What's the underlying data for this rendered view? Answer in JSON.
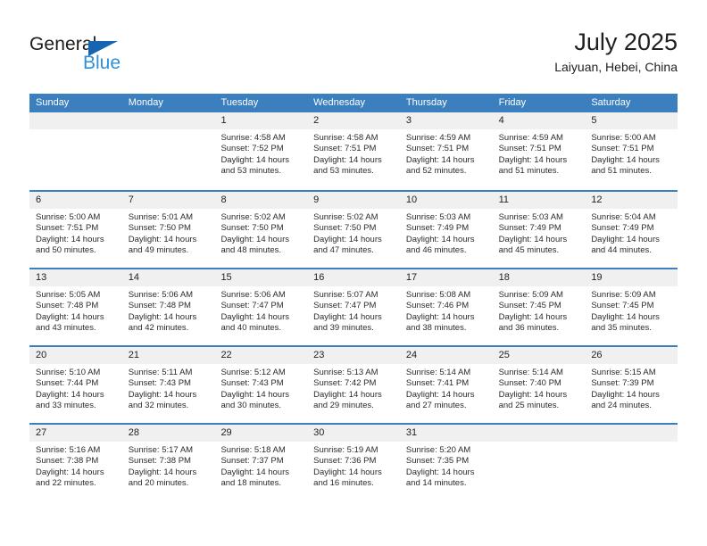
{
  "brand": {
    "name_top": "General",
    "name_bottom": "Blue",
    "triangle_color": "#1565b0",
    "blue_text_color": "#2f8fd8"
  },
  "header": {
    "title": "July 2025",
    "location": "Laiyuan, Hebei, China"
  },
  "theme": {
    "header_bar": "#3c7fbe",
    "day_number_band": "#f0f0f0",
    "cell_background": "#ffffff",
    "text": "#222222"
  },
  "weekdays": [
    "Sunday",
    "Monday",
    "Tuesday",
    "Wednesday",
    "Thursday",
    "Friday",
    "Saturday"
  ],
  "labels": {
    "sunrise_prefix": "Sunrise:",
    "sunset_prefix": "Sunset:",
    "daylight_prefix": "Daylight:"
  },
  "weeks": [
    [
      {
        "day": "",
        "empty": true
      },
      {
        "day": "",
        "empty": true
      },
      {
        "day": "1",
        "sunrise": "Sunrise: 4:58 AM",
        "sunset": "Sunset: 7:52 PM",
        "daylight_line1": "Daylight: 14 hours",
        "daylight_line2": "and 53 minutes."
      },
      {
        "day": "2",
        "sunrise": "Sunrise: 4:58 AM",
        "sunset": "Sunset: 7:51 PM",
        "daylight_line1": "Daylight: 14 hours",
        "daylight_line2": "and 53 minutes."
      },
      {
        "day": "3",
        "sunrise": "Sunrise: 4:59 AM",
        "sunset": "Sunset: 7:51 PM",
        "daylight_line1": "Daylight: 14 hours",
        "daylight_line2": "and 52 minutes."
      },
      {
        "day": "4",
        "sunrise": "Sunrise: 4:59 AM",
        "sunset": "Sunset: 7:51 PM",
        "daylight_line1": "Daylight: 14 hours",
        "daylight_line2": "and 51 minutes."
      },
      {
        "day": "5",
        "sunrise": "Sunrise: 5:00 AM",
        "sunset": "Sunset: 7:51 PM",
        "daylight_line1": "Daylight: 14 hours",
        "daylight_line2": "and 51 minutes."
      }
    ],
    [
      {
        "day": "6",
        "sunrise": "Sunrise: 5:00 AM",
        "sunset": "Sunset: 7:51 PM",
        "daylight_line1": "Daylight: 14 hours",
        "daylight_line2": "and 50 minutes."
      },
      {
        "day": "7",
        "sunrise": "Sunrise: 5:01 AM",
        "sunset": "Sunset: 7:50 PM",
        "daylight_line1": "Daylight: 14 hours",
        "daylight_line2": "and 49 minutes."
      },
      {
        "day": "8",
        "sunrise": "Sunrise: 5:02 AM",
        "sunset": "Sunset: 7:50 PM",
        "daylight_line1": "Daylight: 14 hours",
        "daylight_line2": "and 48 minutes."
      },
      {
        "day": "9",
        "sunrise": "Sunrise: 5:02 AM",
        "sunset": "Sunset: 7:50 PM",
        "daylight_line1": "Daylight: 14 hours",
        "daylight_line2": "and 47 minutes."
      },
      {
        "day": "10",
        "sunrise": "Sunrise: 5:03 AM",
        "sunset": "Sunset: 7:49 PM",
        "daylight_line1": "Daylight: 14 hours",
        "daylight_line2": "and 46 minutes."
      },
      {
        "day": "11",
        "sunrise": "Sunrise: 5:03 AM",
        "sunset": "Sunset: 7:49 PM",
        "daylight_line1": "Daylight: 14 hours",
        "daylight_line2": "and 45 minutes."
      },
      {
        "day": "12",
        "sunrise": "Sunrise: 5:04 AM",
        "sunset": "Sunset: 7:49 PM",
        "daylight_line1": "Daylight: 14 hours",
        "daylight_line2": "and 44 minutes."
      }
    ],
    [
      {
        "day": "13",
        "sunrise": "Sunrise: 5:05 AM",
        "sunset": "Sunset: 7:48 PM",
        "daylight_line1": "Daylight: 14 hours",
        "daylight_line2": "and 43 minutes."
      },
      {
        "day": "14",
        "sunrise": "Sunrise: 5:06 AM",
        "sunset": "Sunset: 7:48 PM",
        "daylight_line1": "Daylight: 14 hours",
        "daylight_line2": "and 42 minutes."
      },
      {
        "day": "15",
        "sunrise": "Sunrise: 5:06 AM",
        "sunset": "Sunset: 7:47 PM",
        "daylight_line1": "Daylight: 14 hours",
        "daylight_line2": "and 40 minutes."
      },
      {
        "day": "16",
        "sunrise": "Sunrise: 5:07 AM",
        "sunset": "Sunset: 7:47 PM",
        "daylight_line1": "Daylight: 14 hours",
        "daylight_line2": "and 39 minutes."
      },
      {
        "day": "17",
        "sunrise": "Sunrise: 5:08 AM",
        "sunset": "Sunset: 7:46 PM",
        "daylight_line1": "Daylight: 14 hours",
        "daylight_line2": "and 38 minutes."
      },
      {
        "day": "18",
        "sunrise": "Sunrise: 5:09 AM",
        "sunset": "Sunset: 7:45 PM",
        "daylight_line1": "Daylight: 14 hours",
        "daylight_line2": "and 36 minutes."
      },
      {
        "day": "19",
        "sunrise": "Sunrise: 5:09 AM",
        "sunset": "Sunset: 7:45 PM",
        "daylight_line1": "Daylight: 14 hours",
        "daylight_line2": "and 35 minutes."
      }
    ],
    [
      {
        "day": "20",
        "sunrise": "Sunrise: 5:10 AM",
        "sunset": "Sunset: 7:44 PM",
        "daylight_line1": "Daylight: 14 hours",
        "daylight_line2": "and 33 minutes."
      },
      {
        "day": "21",
        "sunrise": "Sunrise: 5:11 AM",
        "sunset": "Sunset: 7:43 PM",
        "daylight_line1": "Daylight: 14 hours",
        "daylight_line2": "and 32 minutes."
      },
      {
        "day": "22",
        "sunrise": "Sunrise: 5:12 AM",
        "sunset": "Sunset: 7:43 PM",
        "daylight_line1": "Daylight: 14 hours",
        "daylight_line2": "and 30 minutes."
      },
      {
        "day": "23",
        "sunrise": "Sunrise: 5:13 AM",
        "sunset": "Sunset: 7:42 PM",
        "daylight_line1": "Daylight: 14 hours",
        "daylight_line2": "and 29 minutes."
      },
      {
        "day": "24",
        "sunrise": "Sunrise: 5:14 AM",
        "sunset": "Sunset: 7:41 PM",
        "daylight_line1": "Daylight: 14 hours",
        "daylight_line2": "and 27 minutes."
      },
      {
        "day": "25",
        "sunrise": "Sunrise: 5:14 AM",
        "sunset": "Sunset: 7:40 PM",
        "daylight_line1": "Daylight: 14 hours",
        "daylight_line2": "and 25 minutes."
      },
      {
        "day": "26",
        "sunrise": "Sunrise: 5:15 AM",
        "sunset": "Sunset: 7:39 PM",
        "daylight_line1": "Daylight: 14 hours",
        "daylight_line2": "and 24 minutes."
      }
    ],
    [
      {
        "day": "27",
        "sunrise": "Sunrise: 5:16 AM",
        "sunset": "Sunset: 7:38 PM",
        "daylight_line1": "Daylight: 14 hours",
        "daylight_line2": "and 22 minutes."
      },
      {
        "day": "28",
        "sunrise": "Sunrise: 5:17 AM",
        "sunset": "Sunset: 7:38 PM",
        "daylight_line1": "Daylight: 14 hours",
        "daylight_line2": "and 20 minutes."
      },
      {
        "day": "29",
        "sunrise": "Sunrise: 5:18 AM",
        "sunset": "Sunset: 7:37 PM",
        "daylight_line1": "Daylight: 14 hours",
        "daylight_line2": "and 18 minutes."
      },
      {
        "day": "30",
        "sunrise": "Sunrise: 5:19 AM",
        "sunset": "Sunset: 7:36 PM",
        "daylight_line1": "Daylight: 14 hours",
        "daylight_line2": "and 16 minutes."
      },
      {
        "day": "31",
        "sunrise": "Sunrise: 5:20 AM",
        "sunset": "Sunset: 7:35 PM",
        "daylight_line1": "Daylight: 14 hours",
        "daylight_line2": "and 14 minutes."
      },
      {
        "day": "",
        "empty": true
      },
      {
        "day": "",
        "empty": true
      }
    ]
  ]
}
